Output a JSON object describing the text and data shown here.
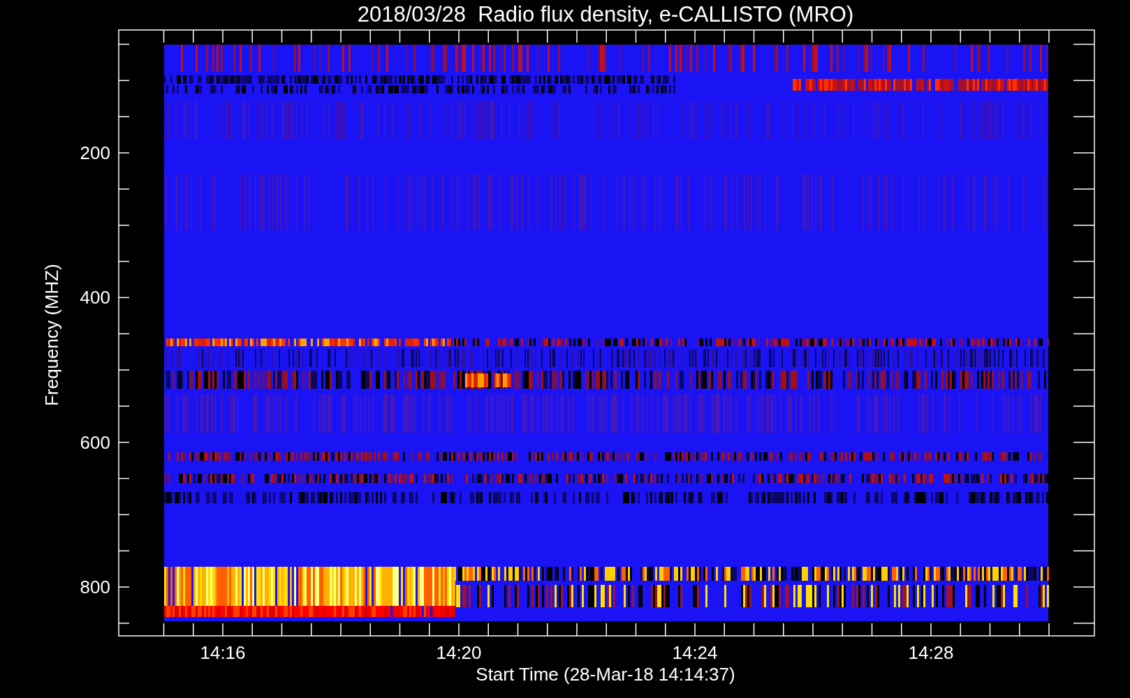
{
  "title": "2018/03/28  Radio flux density, e-CALLISTO (MRO)",
  "y_axis": {
    "label": "Frequency (MHZ)",
    "ticks": [
      "200",
      "400",
      "600",
      "800"
    ]
  },
  "x_axis": {
    "label": "Start Time (28-Mar-18 14:14:37)",
    "ticks": [
      "14:16",
      "14:20",
      "14:24",
      "14:28"
    ]
  }
}
